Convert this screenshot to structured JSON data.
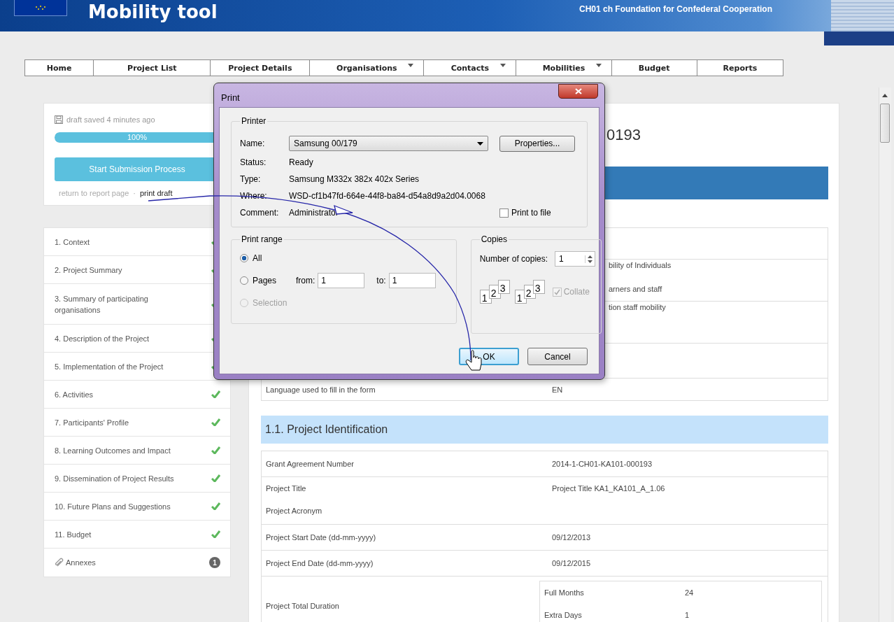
{
  "header": {
    "title": "Mobility tool",
    "organisation": "CH01 ch Foundation for Confederal Cooperation"
  },
  "nav": [
    {
      "label": "Home",
      "dropdown": false
    },
    {
      "label": "Project List",
      "dropdown": false
    },
    {
      "label": "Project Details",
      "dropdown": false
    },
    {
      "label": "Organisations",
      "dropdown": true
    },
    {
      "label": "Contacts",
      "dropdown": true
    },
    {
      "label": "Mobilities",
      "dropdown": true
    },
    {
      "label": "Budget",
      "dropdown": false
    },
    {
      "label": "Reports",
      "dropdown": false
    }
  ],
  "sidebar": {
    "save_status": "draft saved 4 minutes ago",
    "progress": {
      "level": 1,
      "label": "100%"
    },
    "submit_button": "Start Submission Process",
    "links": [
      "return to report page",
      "print draft"
    ],
    "link_separator": "·",
    "sections": [
      {
        "kind": "check",
        "label": "1. Context",
        "complete": true
      },
      {
        "kind": "check",
        "label": "2. Project Summary",
        "complete": true
      },
      {
        "kind": "check",
        "label": "3. Summary of participating organisations",
        "complete": true
      },
      {
        "kind": "check",
        "label": "4. Description of the Project",
        "complete": true
      },
      {
        "kind": "check",
        "label": "5. Implementation of the Project",
        "complete": true
      },
      {
        "kind": "check",
        "label": "6. Activities",
        "complete": true
      },
      {
        "kind": "check",
        "label": "7. Participants' Profile",
        "complete": true
      },
      {
        "kind": "check",
        "label": "8. Learning Outcomes and Impact",
        "complete": true
      },
      {
        "kind": "check",
        "label": "9. Dissemination of Project Results",
        "complete": true
      },
      {
        "kind": "check",
        "label": "10. Future Plans and Suggestions",
        "complete": true
      },
      {
        "kind": "check",
        "label": "11. Budget",
        "complete": true
      },
      {
        "kind": "attachment",
        "label": "Annexes",
        "count": "1"
      }
    ]
  },
  "main": {
    "heading": "0193",
    "summary_rows": [
      {},
      {
        "values": [
          "bility of Individuals",
          "arners and staff"
        ]
      },
      {
        "values": [
          "tion staff mobility"
        ]
      },
      {},
      {
        "label": "Language used to fill in the form",
        "values": [
          "EN"
        ]
      }
    ],
    "identification": {
      "title": "1.1. Project Identification",
      "rows": [
        [
          {
            "label": "Grant Agreement Number",
            "value": "2014-1-CH01-KA101-000193"
          }
        ],
        [
          {
            "label": "Project Title",
            "value": "Project Title KA1_KA101_A_1.06"
          },
          {
            "label": "Project Acronym"
          }
        ],
        [
          {
            "label": "Project Start Date (dd-mm-yyyy)",
            "value": "09/12/2013"
          }
        ],
        [
          {
            "label": "Project End Date (dd-mm-yyyy)",
            "value": "09/12/2015"
          }
        ],
        [
          {
            "label": "Project Total Duration",
            "details": [
              {
                "label": "Full Months",
                "value": "24"
              },
              {
                "label": "Extra Days",
                "value": "1"
              }
            ]
          }
        ]
      ]
    }
  },
  "print_dialog": {
    "title": "Print",
    "printer": {
      "legend": "Printer",
      "name_label": "Name:",
      "name": "Samsung 00/179",
      "properties_button": "Properties...",
      "info": [
        {
          "label": "Status:",
          "value": "Ready"
        },
        {
          "label": "Type:",
          "value": "Samsung M332x 382x 402x Series"
        },
        {
          "label": "Where:",
          "value": "WSD-cf1b47fd-664e-44f8-ba84-d54a8d9a2d04.0068"
        },
        {
          "label": "Comment:",
          "value": "Administrator"
        }
      ],
      "print_to_file": {
        "label": "Print to file",
        "checked": false
      }
    },
    "range": {
      "legend": "Print range",
      "options": [
        {
          "label": "All",
          "selected": true,
          "disabled": false
        },
        {
          "label": "Pages",
          "selected": false,
          "disabled": false
        },
        {
          "label": "Selection",
          "selected": false,
          "disabled": true
        }
      ],
      "from_label": "from:",
      "from": "1",
      "to_label": "to:",
      "to": "1"
    },
    "copies": {
      "legend": "Copies",
      "label": "Number of copies:",
      "value": "1",
      "collate_icons": [
        [
          "1",
          "2",
          "3"
        ],
        [
          "1",
          "2",
          "3"
        ]
      ],
      "collate": {
        "label": "Collate",
        "checked": true,
        "disabled": true
      }
    },
    "buttons": [
      {
        "label": "OK",
        "default": true
      },
      {
        "label": "Cancel",
        "default": false
      }
    ]
  }
}
